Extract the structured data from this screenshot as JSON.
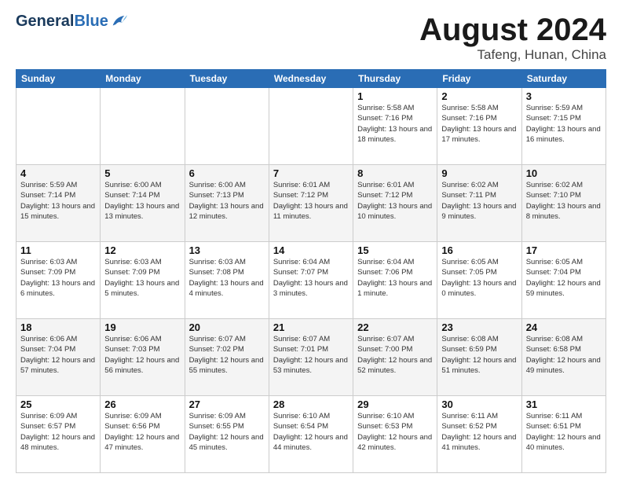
{
  "logo": {
    "general": "General",
    "blue": "Blue"
  },
  "title": {
    "month_year": "August 2024",
    "location": "Tafeng, Hunan, China"
  },
  "days_of_week": [
    "Sunday",
    "Monday",
    "Tuesday",
    "Wednesday",
    "Thursday",
    "Friday",
    "Saturday"
  ],
  "weeks": [
    [
      {
        "day": "",
        "info": ""
      },
      {
        "day": "",
        "info": ""
      },
      {
        "day": "",
        "info": ""
      },
      {
        "day": "",
        "info": ""
      },
      {
        "day": "1",
        "info": "Sunrise: 5:58 AM\nSunset: 7:16 PM\nDaylight: 13 hours and 18 minutes."
      },
      {
        "day": "2",
        "info": "Sunrise: 5:58 AM\nSunset: 7:16 PM\nDaylight: 13 hours and 17 minutes."
      },
      {
        "day": "3",
        "info": "Sunrise: 5:59 AM\nSunset: 7:15 PM\nDaylight: 13 hours and 16 minutes."
      }
    ],
    [
      {
        "day": "4",
        "info": "Sunrise: 5:59 AM\nSunset: 7:14 PM\nDaylight: 13 hours and 15 minutes."
      },
      {
        "day": "5",
        "info": "Sunrise: 6:00 AM\nSunset: 7:14 PM\nDaylight: 13 hours and 13 minutes."
      },
      {
        "day": "6",
        "info": "Sunrise: 6:00 AM\nSunset: 7:13 PM\nDaylight: 13 hours and 12 minutes."
      },
      {
        "day": "7",
        "info": "Sunrise: 6:01 AM\nSunset: 7:12 PM\nDaylight: 13 hours and 11 minutes."
      },
      {
        "day": "8",
        "info": "Sunrise: 6:01 AM\nSunset: 7:12 PM\nDaylight: 13 hours and 10 minutes."
      },
      {
        "day": "9",
        "info": "Sunrise: 6:02 AM\nSunset: 7:11 PM\nDaylight: 13 hours and 9 minutes."
      },
      {
        "day": "10",
        "info": "Sunrise: 6:02 AM\nSunset: 7:10 PM\nDaylight: 13 hours and 8 minutes."
      }
    ],
    [
      {
        "day": "11",
        "info": "Sunrise: 6:03 AM\nSunset: 7:09 PM\nDaylight: 13 hours and 6 minutes."
      },
      {
        "day": "12",
        "info": "Sunrise: 6:03 AM\nSunset: 7:09 PM\nDaylight: 13 hours and 5 minutes."
      },
      {
        "day": "13",
        "info": "Sunrise: 6:03 AM\nSunset: 7:08 PM\nDaylight: 13 hours and 4 minutes."
      },
      {
        "day": "14",
        "info": "Sunrise: 6:04 AM\nSunset: 7:07 PM\nDaylight: 13 hours and 3 minutes."
      },
      {
        "day": "15",
        "info": "Sunrise: 6:04 AM\nSunset: 7:06 PM\nDaylight: 13 hours and 1 minute."
      },
      {
        "day": "16",
        "info": "Sunrise: 6:05 AM\nSunset: 7:05 PM\nDaylight: 13 hours and 0 minutes."
      },
      {
        "day": "17",
        "info": "Sunrise: 6:05 AM\nSunset: 7:04 PM\nDaylight: 12 hours and 59 minutes."
      }
    ],
    [
      {
        "day": "18",
        "info": "Sunrise: 6:06 AM\nSunset: 7:04 PM\nDaylight: 12 hours and 57 minutes."
      },
      {
        "day": "19",
        "info": "Sunrise: 6:06 AM\nSunset: 7:03 PM\nDaylight: 12 hours and 56 minutes."
      },
      {
        "day": "20",
        "info": "Sunrise: 6:07 AM\nSunset: 7:02 PM\nDaylight: 12 hours and 55 minutes."
      },
      {
        "day": "21",
        "info": "Sunrise: 6:07 AM\nSunset: 7:01 PM\nDaylight: 12 hours and 53 minutes."
      },
      {
        "day": "22",
        "info": "Sunrise: 6:07 AM\nSunset: 7:00 PM\nDaylight: 12 hours and 52 minutes."
      },
      {
        "day": "23",
        "info": "Sunrise: 6:08 AM\nSunset: 6:59 PM\nDaylight: 12 hours and 51 minutes."
      },
      {
        "day": "24",
        "info": "Sunrise: 6:08 AM\nSunset: 6:58 PM\nDaylight: 12 hours and 49 minutes."
      }
    ],
    [
      {
        "day": "25",
        "info": "Sunrise: 6:09 AM\nSunset: 6:57 PM\nDaylight: 12 hours and 48 minutes."
      },
      {
        "day": "26",
        "info": "Sunrise: 6:09 AM\nSunset: 6:56 PM\nDaylight: 12 hours and 47 minutes."
      },
      {
        "day": "27",
        "info": "Sunrise: 6:09 AM\nSunset: 6:55 PM\nDaylight: 12 hours and 45 minutes."
      },
      {
        "day": "28",
        "info": "Sunrise: 6:10 AM\nSunset: 6:54 PM\nDaylight: 12 hours and 44 minutes."
      },
      {
        "day": "29",
        "info": "Sunrise: 6:10 AM\nSunset: 6:53 PM\nDaylight: 12 hours and 42 minutes."
      },
      {
        "day": "30",
        "info": "Sunrise: 6:11 AM\nSunset: 6:52 PM\nDaylight: 12 hours and 41 minutes."
      },
      {
        "day": "31",
        "info": "Sunrise: 6:11 AM\nSunset: 6:51 PM\nDaylight: 12 hours and 40 minutes."
      }
    ]
  ]
}
